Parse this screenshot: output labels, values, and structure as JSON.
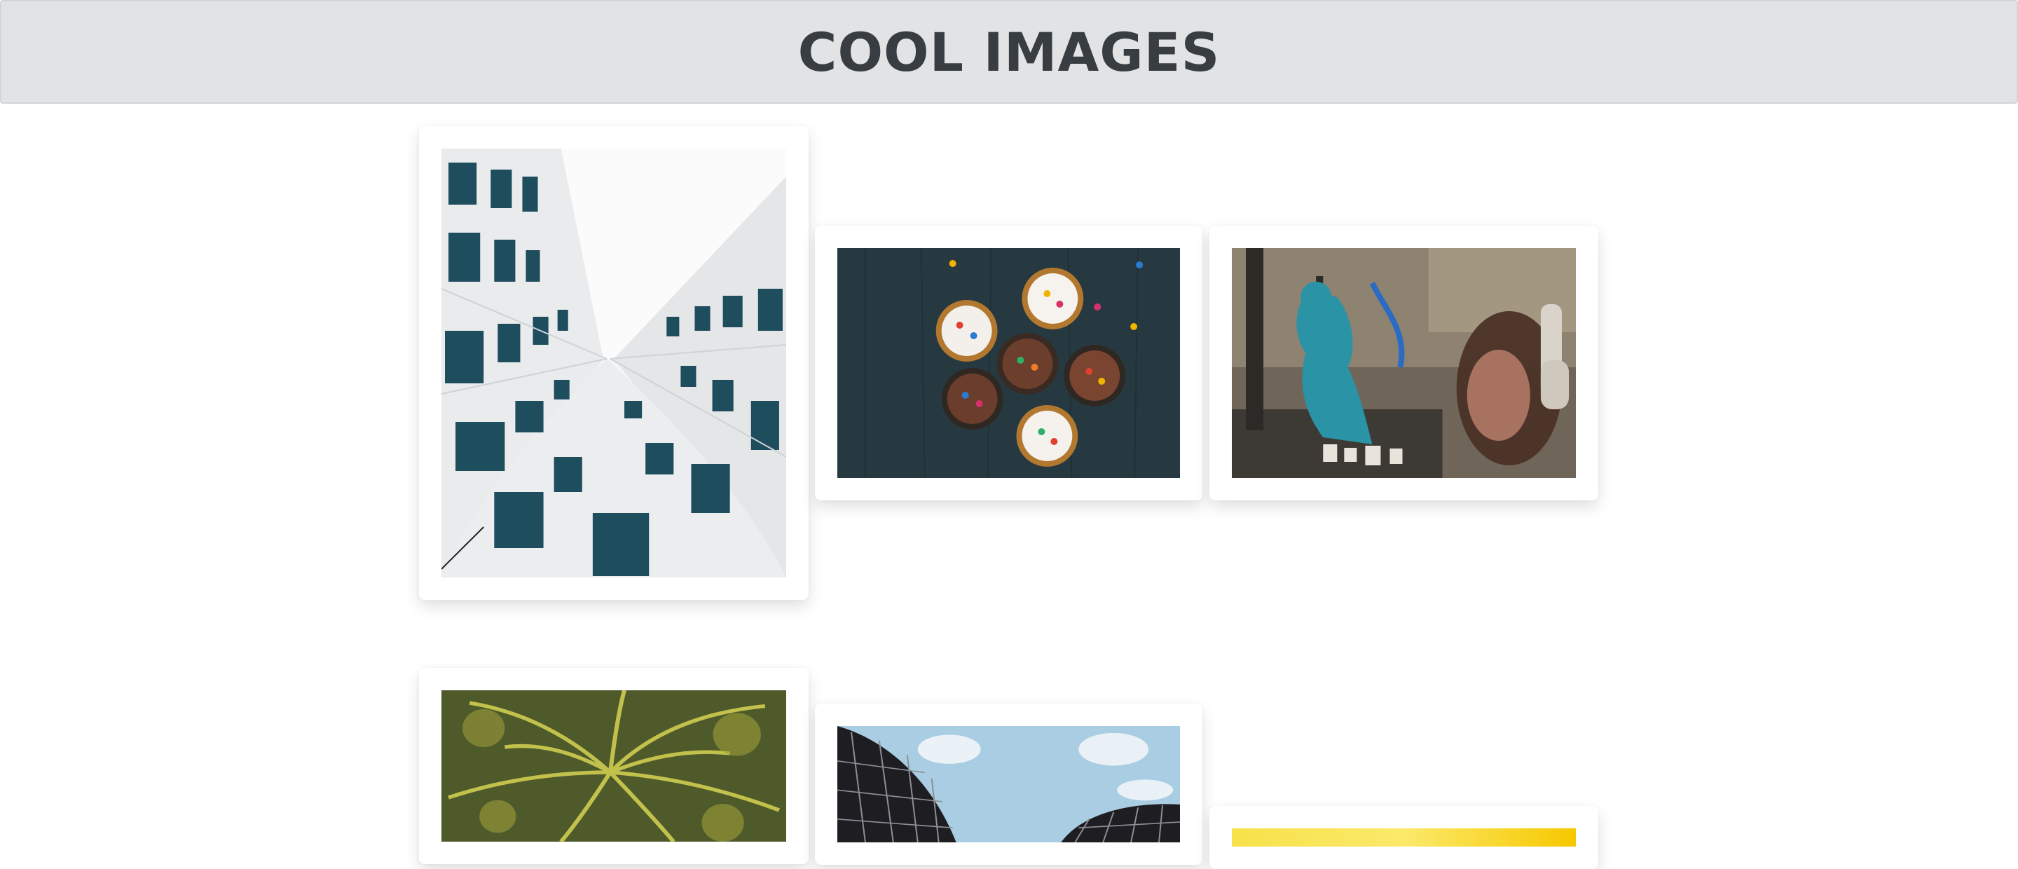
{
  "header": {
    "title": "COOL IMAGES"
  },
  "gallery": {
    "images": [
      {
        "name": "building-looking-up"
      },
      {
        "name": "cupcakes"
      },
      {
        "name": "graffiti-woman-headphones"
      },
      {
        "name": "palm-trees"
      },
      {
        "name": "curved-glass-buildings"
      },
      {
        "name": "yellow-image"
      }
    ]
  }
}
